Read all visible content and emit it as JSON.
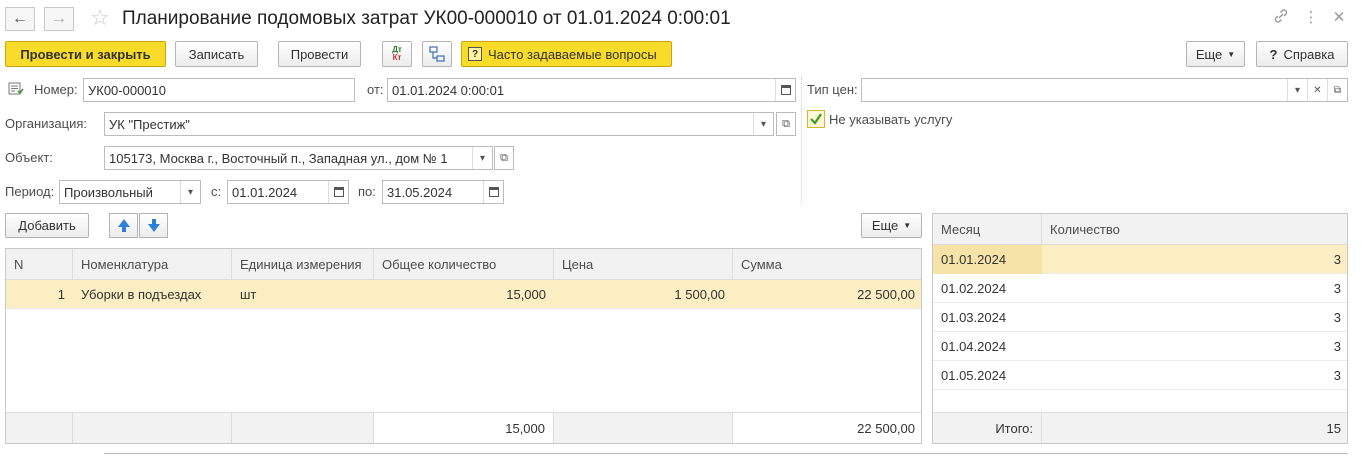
{
  "window": {
    "title": "Планирование подомовых затрат УК00-000010 от 01.01.2024 0:00:01",
    "icons": [
      "back-arrow",
      "forward-arrow",
      "star",
      "link",
      "more-vertical",
      "close"
    ]
  },
  "toolbar": {
    "post_and_close": "Провести и закрыть",
    "write": "Записать",
    "post": "Провести",
    "dt_kt_top": "Дт",
    "dt_kt_bottom": "Кт",
    "faq": "Часто задаваемые вопросы",
    "faq_glyph": "?",
    "more": "Еще",
    "help": "Справка",
    "help_glyph": "?"
  },
  "form": {
    "number_label": "Номер:",
    "number_value": "УК00-000010",
    "date_label": "от:",
    "date_value": "01.01.2024  0:00:01",
    "org_label": "Организация:",
    "org_value": "УК \"Престиж\"",
    "object_label": "Объект:",
    "object_value": "105173, Москва г., Восточный п., Западная ул., дом № 1",
    "period_label": "Период:",
    "period_value": "Произвольный",
    "from_label": "с:",
    "from_value": "01.01.2024",
    "to_label": "по:",
    "to_value": "31.05.2024",
    "price_type_label": "Тип цен:",
    "price_type_value": "",
    "no_service_label": "Не указывать услугу",
    "no_service_checked": true
  },
  "items_toolbar": {
    "add": "Добавить",
    "more": "Еще"
  },
  "items_table": {
    "columns": [
      "N",
      "Номенклатура",
      "Единица измерения",
      "Общее количество",
      "Цена",
      "Сумма"
    ],
    "rows": [
      {
        "n": "1",
        "item": "Уборки в подъездах",
        "unit": "шт",
        "qty": "15,000",
        "price": "1 500,00",
        "sum": "22 500,00"
      }
    ],
    "footer": {
      "qty": "15,000",
      "sum": "22 500,00"
    }
  },
  "months_table": {
    "columns": [
      "Месяц",
      "Количество"
    ],
    "rows": [
      {
        "month": "01.01.2024",
        "qty": "3"
      },
      {
        "month": "01.02.2024",
        "qty": "3"
      },
      {
        "month": "01.03.2024",
        "qty": "3"
      },
      {
        "month": "01.04.2024",
        "qty": "3"
      },
      {
        "month": "01.05.2024",
        "qty": "3"
      }
    ],
    "footer_label": "Итого:",
    "footer_total": "15"
  },
  "colors": {
    "accent_yellow": "#f9db2a",
    "selected_row": "#fbeec2",
    "arrow_blue": "#2f7fd8",
    "check_green": "#3a9a2a"
  }
}
